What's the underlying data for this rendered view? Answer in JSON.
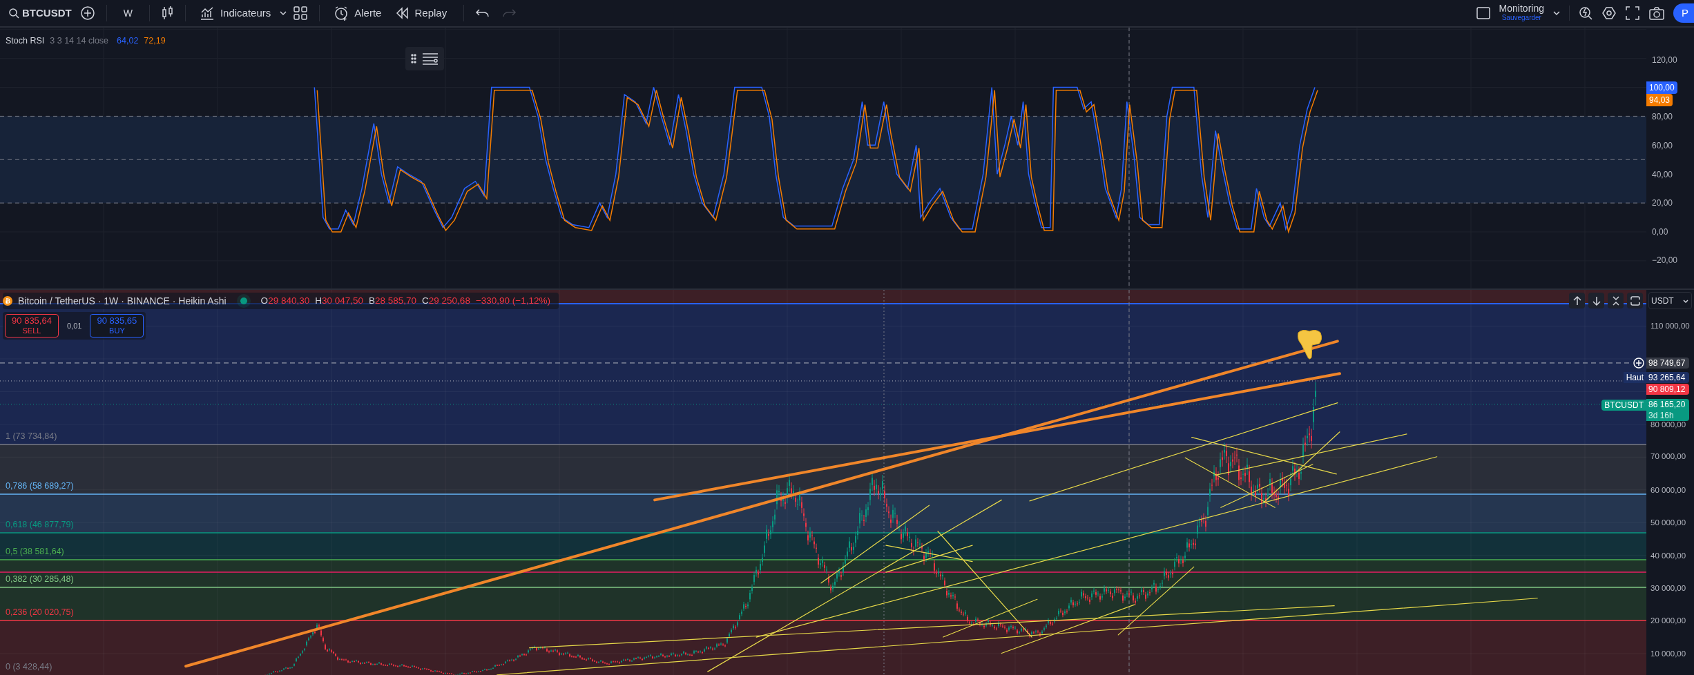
{
  "toolbar": {
    "symbol": "BTCUSDT",
    "interval": "W",
    "indicators": "Indicateurs",
    "alert": "Alerte",
    "replay": "Replay",
    "redo_disabled": true,
    "layout": {
      "name": "Monitoring",
      "status": "Sauvegarder"
    },
    "publish": "P"
  },
  "stoch_pane": {
    "legend": {
      "name": "Stoch RSI",
      "params": "3 3 14 14 close",
      "k_value": "64,02",
      "d_value": "72,19"
    },
    "axis": [
      "120,00",
      "80,00",
      "60,00",
      "40,00",
      "20,00",
      "0,00",
      "−20,00"
    ],
    "badges": [
      {
        "text": "100,00",
        "color": "#2962ff"
      },
      {
        "text": "94,03",
        "color": "#f57c00"
      }
    ]
  },
  "price_pane": {
    "legend": {
      "title": "Bitcoin / TetherUS · 1W · BINANCE · Heikin Ashi",
      "ohlc": [
        {
          "key": "O",
          "value": "29 840,30"
        },
        {
          "key": "H",
          "value": "30 047,50"
        },
        {
          "key": "B",
          "value": "28 585,70"
        },
        {
          "key": "C",
          "value": "29 250,68"
        }
      ],
      "change": "−330,90 (−1,12%)"
    },
    "trade": {
      "sell_price": "90 835,64",
      "sell_label": "SELL",
      "spread": "0,01",
      "buy_price": "90 835,65",
      "buy_label": "BUY"
    },
    "currency": "USDT",
    "axis": [
      "110 000,00",
      "80 000,00",
      "70 000,00",
      "60 000,00",
      "50 000,00",
      "40 000,00",
      "30 000,00",
      "20 000,00",
      "10 000,00"
    ],
    "price_labels": [
      {
        "kind": "line",
        "text": "98 749,67"
      },
      {
        "kind": "high",
        "tag": "Haut",
        "text": "93 265,64"
      },
      {
        "kind": "alert",
        "text": "90 809,12"
      },
      {
        "kind": "last",
        "tag": "BTCUSDT",
        "text": "86 165,20",
        "countdown": "3d 16h"
      }
    ],
    "fib_levels": [
      {
        "label": "1 (73 734,84)",
        "color": "#787b86"
      },
      {
        "label": "0,786 (58 689,27)",
        "color": "#64b5f6"
      },
      {
        "label": "0,618 (46 877,79)",
        "color": "#089981"
      },
      {
        "label": "0,5 (38 581,64)",
        "color": "#4caf50"
      },
      {
        "label": "0,382 (30 285,48)",
        "color": "#81c784"
      },
      {
        "label": "0,236 (20 020,75)",
        "color": "#f23645"
      },
      {
        "label": "0 (3 428,44)",
        "color": "#787b86"
      }
    ]
  }
}
